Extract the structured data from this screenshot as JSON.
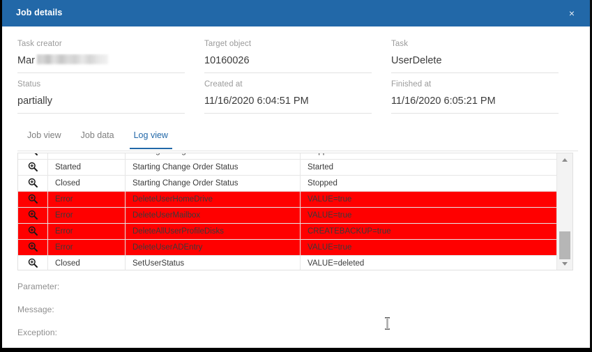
{
  "window": {
    "title": "Job details",
    "close_label": "×",
    "header_color": "#2268A8"
  },
  "details": {
    "fields": [
      {
        "label": "Task creator",
        "value": "Mar",
        "redacted": true
      },
      {
        "label": "Target object",
        "value": "10160026",
        "redacted": false
      },
      {
        "label": "Task",
        "value": "UserDelete",
        "redacted": false
      },
      {
        "label": "Status",
        "value": "partially",
        "redacted": false
      },
      {
        "label": "Created at",
        "value": "11/16/2020 6:04:51 PM",
        "redacted": false
      },
      {
        "label": "Finished at",
        "value": "11/16/2020 6:05:21 PM",
        "redacted": false
      }
    ]
  },
  "tabs": {
    "items": [
      {
        "label": "Job view",
        "active": false
      },
      {
        "label": "Job data",
        "active": false
      },
      {
        "label": "Log view",
        "active": true
      }
    ],
    "active_color": "#2268A8"
  },
  "log": {
    "row_icon": "zoom-in-magnifier-icon",
    "error_color": "#FF0000",
    "rows": [
      {
        "status": "Closed",
        "action": "Starting Change Order Status",
        "value": "stopped",
        "error": false,
        "clipped": true
      },
      {
        "status": "Started",
        "action": "Starting Change Order Status",
        "value": "Started",
        "error": false
      },
      {
        "status": "Closed",
        "action": "Starting Change Order Status",
        "value": "Stopped",
        "error": false
      },
      {
        "status": "Error",
        "action": "DeleteUserHomeDrive",
        "value": "VALUE=true",
        "error": true
      },
      {
        "status": "Error",
        "action": "DeleteUserMailbox",
        "value": "VALUE=true",
        "error": true
      },
      {
        "status": "Error",
        "action": "DeleteAllUserProfileDisks",
        "value": "CREATEBACKUP=true",
        "error": true
      },
      {
        "status": "Error",
        "action": "DeleteUserADEntry",
        "value": "VALUE=true",
        "error": true
      },
      {
        "status": "Closed",
        "action": "SetUserStatus",
        "value": "VALUE=deleted",
        "error": false
      }
    ]
  },
  "detail_labels": {
    "parameter": "Parameter:",
    "message": "Message:",
    "exception": "Exception:"
  }
}
